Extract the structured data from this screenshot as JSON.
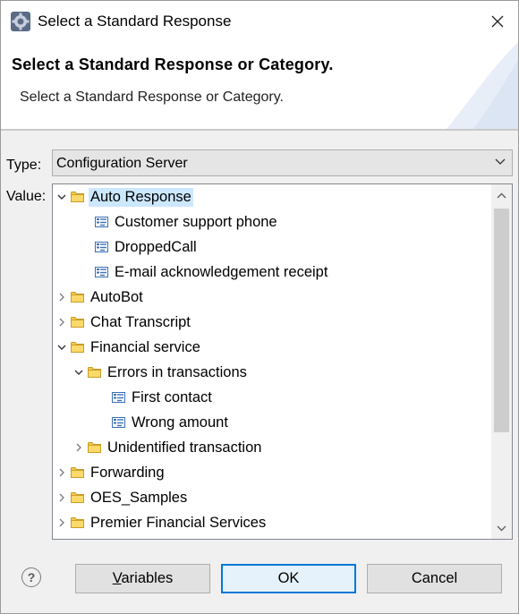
{
  "window": {
    "title": "Select a Standard Response",
    "app_icon": "gear-app-icon",
    "close_icon": "close-icon"
  },
  "banner": {
    "title": "Select a Standard Response or Category.",
    "description": "Select a Standard Response or Category."
  },
  "form": {
    "type_label": "Type:",
    "type_value": "Configuration Server",
    "value_label": "Value:"
  },
  "tree": {
    "selected": "Auto Response",
    "rows": [
      {
        "label": "Auto Response",
        "kind": "folder",
        "depth": 0,
        "expanded": true,
        "selected": true
      },
      {
        "label": "Customer support phone",
        "kind": "response",
        "depth": 1
      },
      {
        "label": "DroppedCall",
        "kind": "response",
        "depth": 1
      },
      {
        "label": "E-mail acknowledgement receipt",
        "kind": "response",
        "depth": 1
      },
      {
        "label": "AutoBot",
        "kind": "folder",
        "depth": 0,
        "expanded": false
      },
      {
        "label": "Chat Transcript",
        "kind": "folder",
        "depth": 0,
        "expanded": false
      },
      {
        "label": "Financial service",
        "kind": "folder",
        "depth": 0,
        "expanded": true
      },
      {
        "label": "Errors in transactions",
        "kind": "folder",
        "depth": 1,
        "expanded": true
      },
      {
        "label": "First contact",
        "kind": "response",
        "depth": 2
      },
      {
        "label": "Wrong amount",
        "kind": "response",
        "depth": 2
      },
      {
        "label": "Unidentified transaction",
        "kind": "folder",
        "depth": 1,
        "expanded": false
      },
      {
        "label": "Forwarding",
        "kind": "folder",
        "depth": 0,
        "expanded": false
      },
      {
        "label": "OES_Samples",
        "kind": "folder",
        "depth": 0,
        "expanded": false
      },
      {
        "label": "Premier Financial Services",
        "kind": "folder",
        "depth": 0,
        "expanded": false
      }
    ]
  },
  "buttons": {
    "help": "?",
    "variables": "Variables",
    "ok": "OK",
    "cancel": "Cancel"
  },
  "colors": {
    "selection": "#cce8ff",
    "default_button_border": "#0078d7",
    "folder": "#f6c94a"
  }
}
